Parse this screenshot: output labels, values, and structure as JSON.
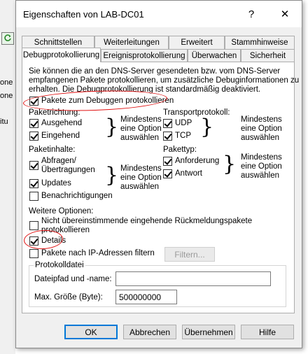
{
  "background": {
    "fragments": [
      "one",
      "one",
      "itu"
    ]
  },
  "dialog": {
    "title": "Eigenschaften von LAB-DC01",
    "help_label": "?",
    "close_label": "✕",
    "tabs_row1": [
      "Schnittstellen",
      "Weiterleitungen",
      "Erweitert",
      "Stammhinweise"
    ],
    "tabs_row2": [
      "Debugprotokollierung",
      "Ereignisprotokollierung",
      "Überwachen",
      "Sicherheit"
    ],
    "description": [
      "Sie können die an den DNS-Server gesendeten bzw. vom DNS-Server",
      "empfangenen Pakete protokollieren, um zusätzliche Debuginformationen zu",
      "erhalten. Die Debugprotokollierung ist standardmäßig deaktiviert."
    ],
    "log_packets": "Pakete zum Debuggen protokollieren",
    "direction": {
      "label": "Paketrichtung:",
      "outgoing": "Ausgehend",
      "incoming": "Eingehend",
      "hint": [
        "Mindestens",
        "eine Option",
        "auswählen"
      ]
    },
    "transport": {
      "label": "Transportprotokoll:",
      "udp": "UDP",
      "tcp": "TCP",
      "hint": [
        "Mindestens",
        "eine Option",
        "auswählen"
      ]
    },
    "contents": {
      "label": "Paketinhalte:",
      "queries": [
        "Abfragen/",
        "Übertragungen"
      ],
      "updates": "Updates",
      "notifications": "Benachrichtigungen",
      "hint": [
        "Mindestens",
        "eine Option",
        "auswählen"
      ]
    },
    "packet_type": {
      "label": "Pakettyp:",
      "request": "Anforderung",
      "response": "Antwort",
      "hint": [
        "Mindestens",
        "eine Option",
        "auswählen"
      ]
    },
    "more_options": {
      "label": "Weitere Optionen:",
      "unmatched": [
        "Nicht übereinstimmende eingehende Rückmeldungspakete",
        "protokollieren"
      ],
      "details": "Details",
      "filter_ip": "Pakete nach IP-Adressen filtern",
      "filter_button": "Filtern..."
    },
    "logfile": {
      "legend": "Protokolldatei",
      "path_label": "Dateipfad und -name:",
      "path_value": "",
      "size_label": "Max. Größe (Byte):",
      "size_value": "500000000"
    },
    "buttons": {
      "ok": "OK",
      "cancel": "Abbrechen",
      "apply": "Übernehmen",
      "help": "Hilfe"
    },
    "annotation_color": "#e01010"
  }
}
